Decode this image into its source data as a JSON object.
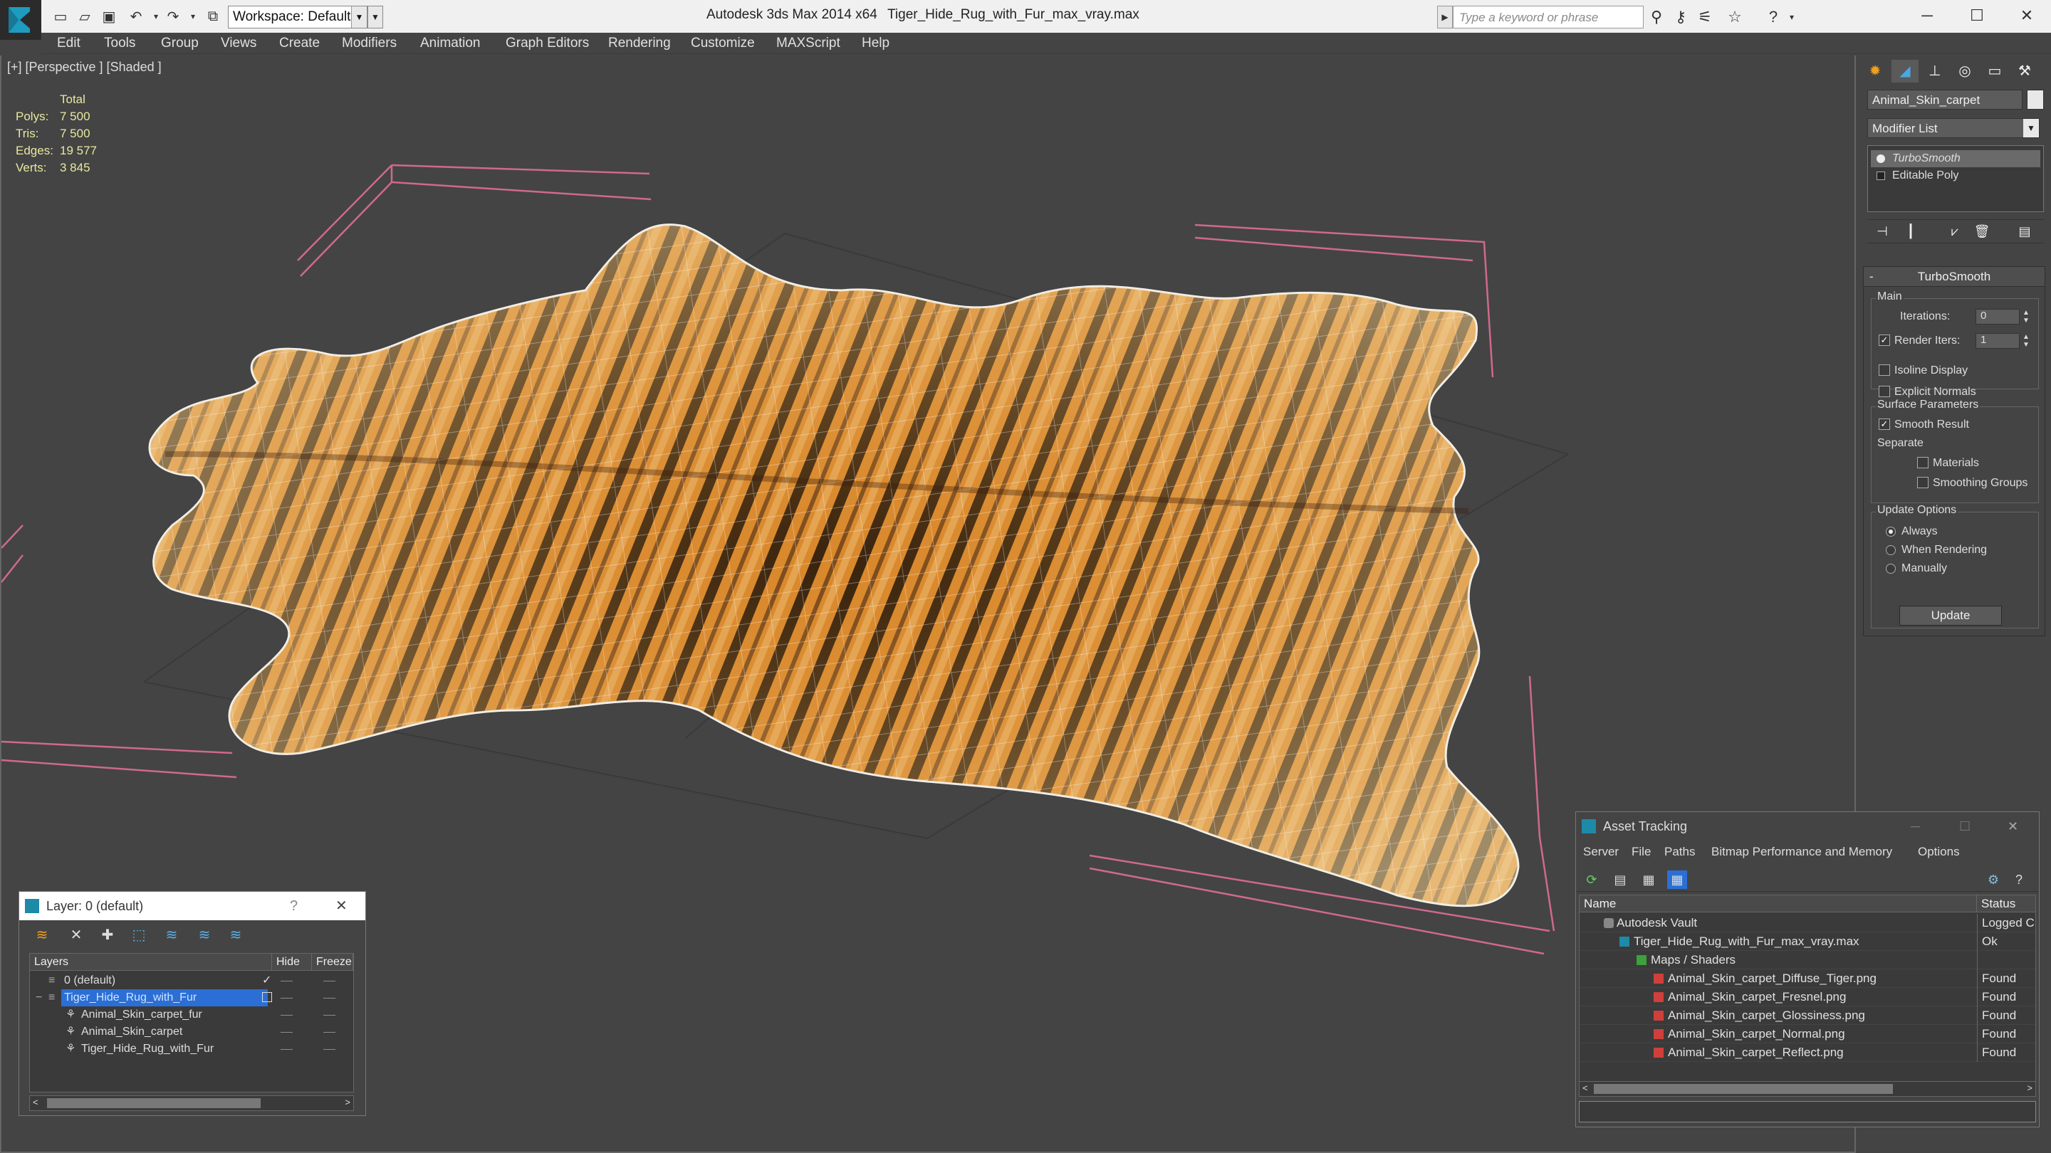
{
  "titlebar": {
    "workspace": "Workspace: Default",
    "app_title": "Autodesk 3ds Max  2014 x64",
    "file_title": "Tiger_Hide_Rug_with_Fur_max_vray.max",
    "search_placeholder": "Type a keyword or phrase"
  },
  "menu": [
    "Edit",
    "Tools",
    "Group",
    "Views",
    "Create",
    "Modifiers",
    "Animation",
    "Graph Editors",
    "Rendering",
    "Customize",
    "MAXScript",
    "Help"
  ],
  "viewport": {
    "label": "[+] [Perspective ] [Shaded ]",
    "stats": {
      "header": "Total",
      "rows": [
        {
          "k": "Polys:",
          "v": "7 500"
        },
        {
          "k": "Tris:",
          "v": "7 500"
        },
        {
          "k": "Edges:",
          "v": "19 577"
        },
        {
          "k": "Verts:",
          "v": "3 845"
        }
      ]
    }
  },
  "command_panel": {
    "object_name": "Animal_Skin_carpet",
    "modifier_list": "Modifier List",
    "stack": [
      "TurboSmooth",
      "Editable Poly"
    ],
    "rollout_title": "TurboSmooth",
    "main_group": "Main",
    "iterations_label": "Iterations:",
    "iterations_value": "0",
    "render_iters_label": "Render Iters:",
    "render_iters_value": "1",
    "isoline": "Isoline Display",
    "explicit_normals": "Explicit Normals",
    "surface_group": "Surface Parameters",
    "smooth_result": "Smooth Result",
    "separate": "Separate",
    "materials": "Materials",
    "smoothing_groups": "Smoothing Groups",
    "update_group": "Update Options",
    "always": "Always",
    "when_rendering": "When Rendering",
    "manually": "Manually",
    "update_button": "Update"
  },
  "layer_dialog": {
    "title": "Layer: 0 (default)",
    "columns": [
      "Layers",
      "Hide",
      "Freeze"
    ],
    "rows": [
      {
        "name": "0 (default)",
        "level": 1
      },
      {
        "name": "Tiger_Hide_Rug_with_Fur",
        "level": 1
      },
      {
        "name": "Animal_Skin_carpet_fur",
        "level": 2
      },
      {
        "name": "Animal_Skin_carpet",
        "level": 2
      },
      {
        "name": "Tiger_Hide_Rug_with_Fur",
        "level": 2
      }
    ]
  },
  "asset_tracking": {
    "title": "Asset Tracking",
    "menu": [
      "Server",
      "File",
      "Paths",
      "Bitmap Performance and Memory",
      "Options"
    ],
    "columns": [
      "Name",
      "Status"
    ],
    "rows": [
      {
        "name": "Autodesk Vault",
        "status": "Logged C",
        "level": 0,
        "icon": "vault-icon"
      },
      {
        "name": "Tiger_Hide_Rug_with_Fur_max_vray.max",
        "status": "Ok",
        "level": 1,
        "icon": "max-file-icon"
      },
      {
        "name": "Maps / Shaders",
        "status": "",
        "level": 2,
        "icon": "maps-icon"
      },
      {
        "name": "Animal_Skin_carpet_Diffuse_Tiger.png",
        "status": "Found",
        "level": 3,
        "icon": "png-icon"
      },
      {
        "name": "Animal_Skin_carpet_Fresnel.png",
        "status": "Found",
        "level": 3,
        "icon": "png-icon"
      },
      {
        "name": "Animal_Skin_carpet_Glossiness.png",
        "status": "Found",
        "level": 3,
        "icon": "png-icon"
      },
      {
        "name": "Animal_Skin_carpet_Normal.png",
        "status": "Found",
        "level": 3,
        "icon": "png-icon"
      },
      {
        "name": "Animal_Skin_carpet_Reflect.png",
        "status": "Found",
        "level": 3,
        "icon": "png-icon"
      }
    ]
  }
}
